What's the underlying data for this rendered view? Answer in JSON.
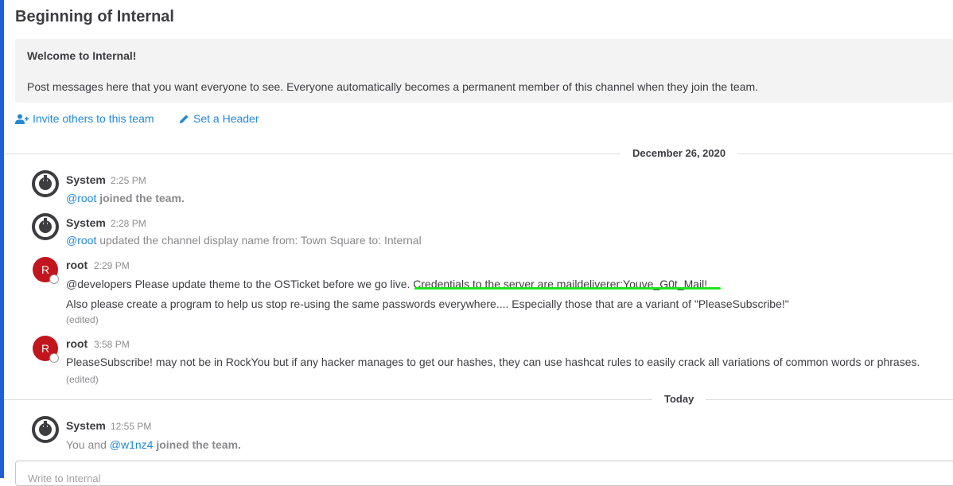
{
  "channel": {
    "intro_title": "Beginning of Internal",
    "welcome_heading": "Welcome to Internal!",
    "welcome_body": "Post messages here that you want everyone to see. Everyone automatically becomes a permanent member of this channel when they join the team.",
    "invite_label": "Invite others to this team",
    "header_label": "Set a Header"
  },
  "separators": {
    "date1": "December 26, 2020",
    "date2": "Today"
  },
  "posts": [
    {
      "user": "System",
      "time": "2:25 PM",
      "mention": "@root",
      "text": "joined the team."
    },
    {
      "user": "System",
      "time": "2:28 PM",
      "mention": "@root",
      "text": "updated the channel display name from: Town Square to: Internal"
    },
    {
      "user": "root",
      "avatar": "R",
      "time": "2:29 PM",
      "line1": "@developers Please update theme to the OSTicket before we go live.  Credentials to the server are maildeliverer:Youve_G0t_Mail!",
      "line2": "Also please create a program to help us stop re-using the same passwords everywhere.... Especially those that are a variant of \"PleaseSubscribe!\"",
      "edited": "(edited)"
    },
    {
      "user": "root",
      "avatar": "R",
      "time": "3:58 PM",
      "line1": "PleaseSubscribe! may not be in RockYou but if any hacker manages to get our hashes, they can use hashcat rules to easily crack all variations of common words or phrases.",
      "edited": "(edited)"
    },
    {
      "user": "System",
      "time": "12:55 PM",
      "prefix": "You and",
      "mention": "@w1nz4",
      "text": "joined the team."
    }
  ],
  "composer": {
    "placeholder": "Write to Internal"
  },
  "colors": {
    "link": "#2389d7",
    "avatar": "#c3151d",
    "highlight": "#1de41d"
  },
  "icons": {
    "invite": "add-user-icon",
    "header": "pencil-icon",
    "system": "mattermost-logo-icon"
  }
}
